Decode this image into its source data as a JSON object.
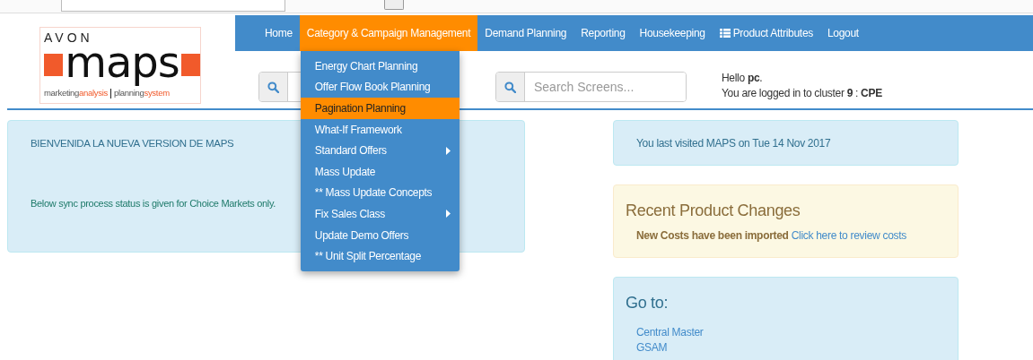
{
  "logo": {
    "brand": "AVON",
    "wordmark": "maps",
    "tagline": [
      {
        "text": "marketing",
        "accent": false
      },
      {
        "text": "analysis",
        "accent": true
      },
      {
        "text": "planning",
        "accent": false
      },
      {
        "text": "system",
        "accent": true
      }
    ]
  },
  "nav": [
    {
      "label": "Home",
      "selected": false,
      "kind": "link"
    },
    {
      "label": "Category & Campaign Management",
      "selected": true,
      "kind": "link"
    },
    {
      "label": "Demand Planning",
      "selected": false,
      "kind": "link"
    },
    {
      "label": "Reporting",
      "selected": false,
      "kind": "link"
    },
    {
      "label": "Housekeeping",
      "selected": false,
      "kind": "link"
    },
    {
      "label": "Product Attributes",
      "selected": false,
      "kind": "list-icon"
    },
    {
      "label": "Logout",
      "selected": false,
      "kind": "link"
    }
  ],
  "menu": [
    {
      "label": "Energy Chart Planning",
      "selected": false,
      "submenu": false
    },
    {
      "label": "Offer Flow Book Planning",
      "selected": false,
      "submenu": false
    },
    {
      "label": "Pagination Planning",
      "selected": true,
      "submenu": false
    },
    {
      "label": "What-If Framework",
      "selected": false,
      "submenu": false
    },
    {
      "label": "Standard Offers",
      "selected": false,
      "submenu": true
    },
    {
      "label": "Mass Update",
      "selected": false,
      "submenu": false
    },
    {
      "label": "** Mass Update Concepts",
      "selected": false,
      "submenu": false
    },
    {
      "label": "Fix Sales Class",
      "selected": false,
      "submenu": true
    },
    {
      "label": "Update Demo Offers",
      "selected": false,
      "submenu": false
    },
    {
      "label": "** Unit Split Percentage",
      "selected": false,
      "submenu": false
    }
  ],
  "search": {
    "placeholder": "Search Screens..."
  },
  "greeting": {
    "hello": "Hello **pc**.",
    "cluster": "You are logged in to cluster **9** : **CPE**"
  },
  "welcome_panel": {
    "title": "BIENVENIDA LA NUEVA VERSION DE MAPS",
    "note": "Below sync process status is given for Choice Markets only."
  },
  "last_visit": "You last visited MAPS on Tue 14 Nov 2017",
  "recent_changes": {
    "title": "Recent Product Changes",
    "message": "New Costs have been imported",
    "link": "Click here to review costs"
  },
  "goto": {
    "title": "Go to:",
    "links": [
      "Central Master",
      "GSAM"
    ]
  }
}
